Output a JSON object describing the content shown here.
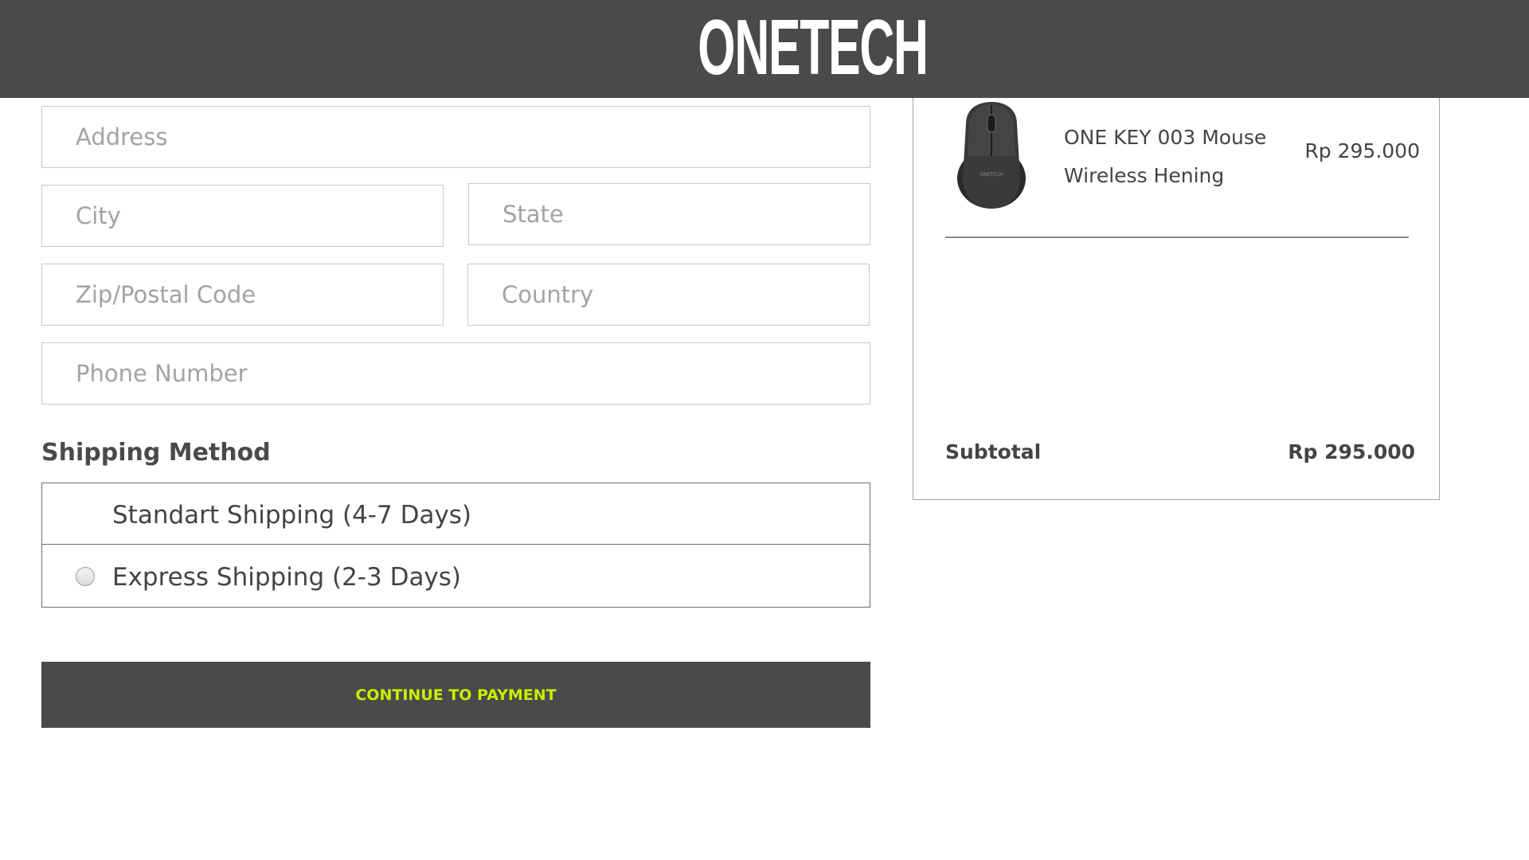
{
  "brand": {
    "logo_text": "ONETECH"
  },
  "form": {
    "address_placeholder": "Address",
    "city_placeholder": "City",
    "state_placeholder": "State",
    "zip_placeholder": "Zip/Postal Code",
    "country_placeholder": "Country",
    "phone_placeholder": "Phone Number"
  },
  "shipping": {
    "title": "Shipping Method",
    "options": [
      {
        "label": "Standart Shipping (4-7 Days)",
        "has_radio": false
      },
      {
        "label": "Express Shipping (2-3 Days)",
        "has_radio": true,
        "selected": false
      }
    ]
  },
  "actions": {
    "continue_label": "CONTINUE TO PAYMENT"
  },
  "order_summary": {
    "items": [
      {
        "name": "ONE KEY 003 Mouse Wireless Hening",
        "price": "Rp 295.000",
        "image_icon": "wireless-mouse",
        "image_brand": "ONETECH"
      }
    ],
    "subtotal_label": "Subtotal",
    "subtotal_value": "Rp 295.000"
  },
  "colors": {
    "header_bg": "#4a4a4a",
    "button_bg": "#4a4a4a",
    "button_text": "#c6f000",
    "field_border": "#c8c8c8"
  }
}
